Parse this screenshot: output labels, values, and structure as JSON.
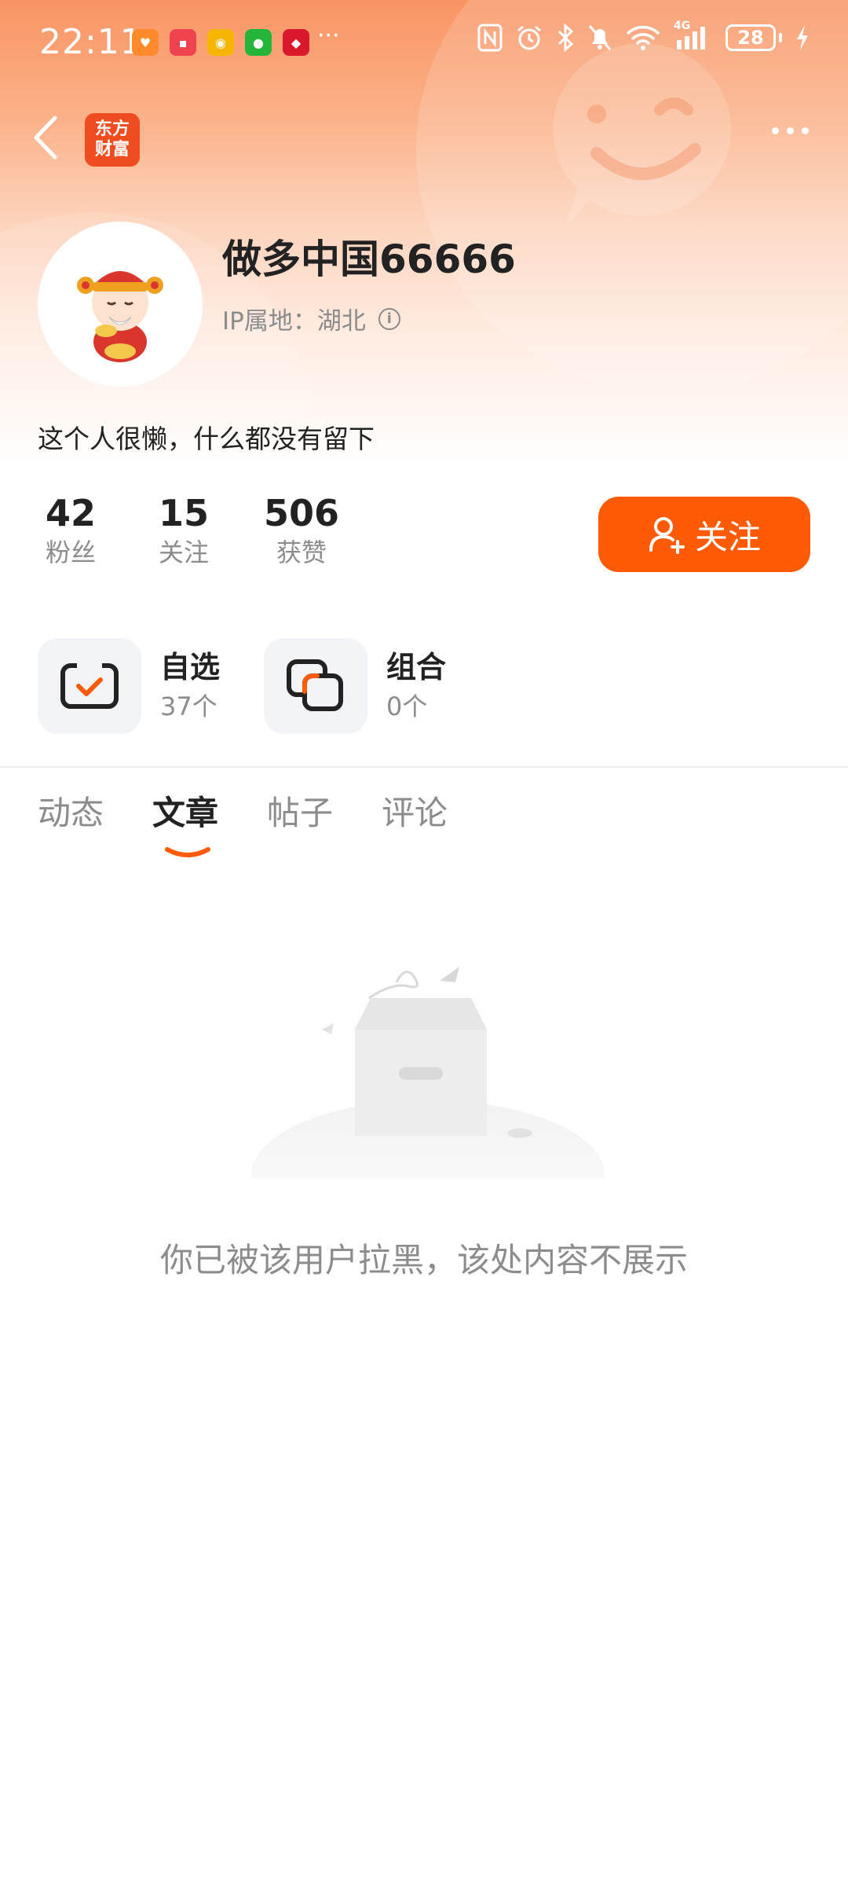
{
  "status_bar": {
    "time": "22:11",
    "more_notifications": "···",
    "battery": "28",
    "network": "4G",
    "app_icons": [
      {
        "name": "heart-app-icon",
        "color": "#ff8a2b",
        "glyph": "♥"
      },
      {
        "name": "huawei-store-icon",
        "color": "#f0434f",
        "glyph": "▪"
      },
      {
        "name": "weibo-icon",
        "color": "#f7b500",
        "glyph": "◉"
      },
      {
        "name": "wechat-icon",
        "color": "#25b53a",
        "glyph": "●"
      },
      {
        "name": "taobao-1111-icon",
        "color": "#d9182b",
        "glyph": "◆"
      }
    ]
  },
  "nav": {
    "logo_line1": "东方",
    "logo_line2": "财富"
  },
  "profile": {
    "username": "做多中国66666",
    "ip_label": "IP属地：湖北",
    "bio": "这个人很懒，什么都没有留下",
    "stats": [
      {
        "value": "42",
        "label": "粉丝"
      },
      {
        "value": "15",
        "label": "关注"
      },
      {
        "value": "506",
        "label": "获赞"
      }
    ],
    "follow_label": "关注"
  },
  "collections": [
    {
      "title": "自选",
      "count": "37个"
    },
    {
      "title": "组合",
      "count": "0个"
    }
  ],
  "tabs": [
    {
      "label": "动态",
      "active": false
    },
    {
      "label": "文章",
      "active": true
    },
    {
      "label": "帖子",
      "active": false
    },
    {
      "label": "评论",
      "active": false
    }
  ],
  "empty_state": {
    "message": "你已被该用户拉黑，该处内容不展示"
  },
  "colors": {
    "accent": "#ff5a05",
    "header_gradient_top": "#f99564",
    "muted_text": "#8c8c8c"
  }
}
